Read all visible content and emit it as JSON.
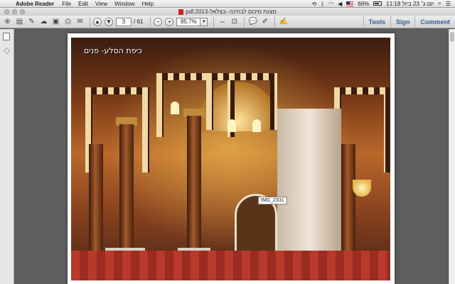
{
  "menubar": {
    "app_name": "Adobe Reader",
    "items": [
      "File",
      "Edit",
      "View",
      "Window",
      "Help"
    ],
    "battery": "66%",
    "clock": "יום ג׳ 23 ביול 11:18"
  },
  "window": {
    "title": "pdf.2013-מצגת סיכום לבחינה -בצלאל"
  },
  "toolbar": {
    "current_page": "3",
    "total_pages": "/ 61",
    "zoom": "85.7%",
    "right_links": [
      "Tools",
      "Sign",
      "Comment"
    ]
  },
  "document": {
    "caption": "כיפת הסלע- פנים",
    "image_label": "IMG_2331"
  }
}
